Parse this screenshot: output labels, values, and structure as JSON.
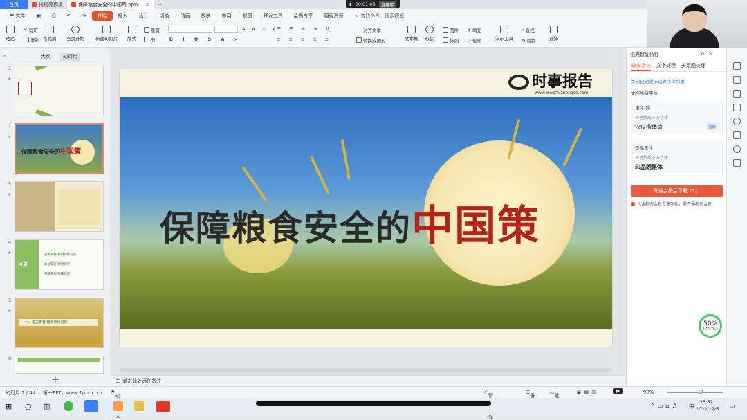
{
  "tabs": {
    "home": "首页",
    "template": "找稻壳模板",
    "document": "保障粮食安全的中国策.pptx"
  },
  "timer": {
    "elapsed": "00:01:05",
    "live": "直播中"
  },
  "menu": {
    "file": "文件",
    "items": [
      "开始",
      "插入",
      "设计",
      "切换",
      "动画",
      "放映",
      "审阅",
      "视图",
      "开发工具",
      "会员专享",
      "稻壳资源"
    ],
    "search": "查找命令、搜索模板"
  },
  "ribbon": {
    "paste": "粘贴",
    "cut": "剪切",
    "copy": "复制",
    "format_painter": "格式刷",
    "from_current": "当页开始",
    "new_slide": "新建幻灯片",
    "layout": "版式",
    "section": "节",
    "reset": "重置",
    "text_direction": "对齐文本",
    "convert_smartart": "转换成图形",
    "textbox": "文本框",
    "shape": "形状",
    "picture": "图片",
    "arrange": "排列",
    "fill": "填充",
    "outline": "轮廓",
    "presenter_tools": "演示工具",
    "find": "查找",
    "replace": "替换",
    "select": "选择"
  },
  "left_panel": {
    "tab_outline": "大纲",
    "tab_slides": "幻灯片",
    "slides": [
      {
        "num": "1"
      },
      {
        "num": "2",
        "title_pre": "保障粮食安全的",
        "title_red": "中国策"
      },
      {
        "num": "3"
      },
      {
        "num": "4",
        "label": "目录",
        "items": [
          "奋力攀登 粮食持续向好",
          "高位攀升 耕地保护",
          "开辟未来 科技赋能"
        ]
      },
      {
        "num": "5",
        "label": "一、奋力攀登 粮食持续向好"
      },
      {
        "num": "6"
      }
    ]
  },
  "slide": {
    "logo_text": "时事报告",
    "logo_url": "www.xingshizhengce.com",
    "title_pre": "保障粮食安全的",
    "title_red": "中国策"
  },
  "notes": "单击此处添加备注",
  "right_panel": {
    "header": "稻壳智能特性",
    "tabs": [
      "缺失字体",
      "文字处理",
      "关系图处理"
    ],
    "link": "关闭自动提示缺失字体列表",
    "section": "文档所缺字体",
    "fonts": [
      {
        "name": "隶体-简",
        "hint": "将替换成下方字体",
        "sample": "汉仪楷体简",
        "badge": "免费"
      },
      {
        "name": "日晶黑体",
        "hint": "将替换成下方字体",
        "sample": "印品朗黑体",
        "badge": ""
      }
    ],
    "download": "开通会员后下载（2）",
    "note": "包含稻壳会员专享字体，需开通稻壳会员"
  },
  "status": {
    "slide_index": "幻灯片 2 / 44",
    "theme": "第一PPT，www.1ppt.com",
    "missing_font": "缺失字体",
    "beautify": "智能美化",
    "notes": "备注",
    "comments": "批注",
    "zoom": "99%"
  },
  "badge": {
    "percent": "50%",
    "speed": "↑44.7K/s"
  },
  "taskbar": {
    "time": "15:52",
    "date": "2022/12/6",
    "ime": "中"
  },
  "colors": {
    "accent": "#e9532c",
    "slide_red": "#b3241a",
    "home_tab": "#3a7cf0"
  }
}
